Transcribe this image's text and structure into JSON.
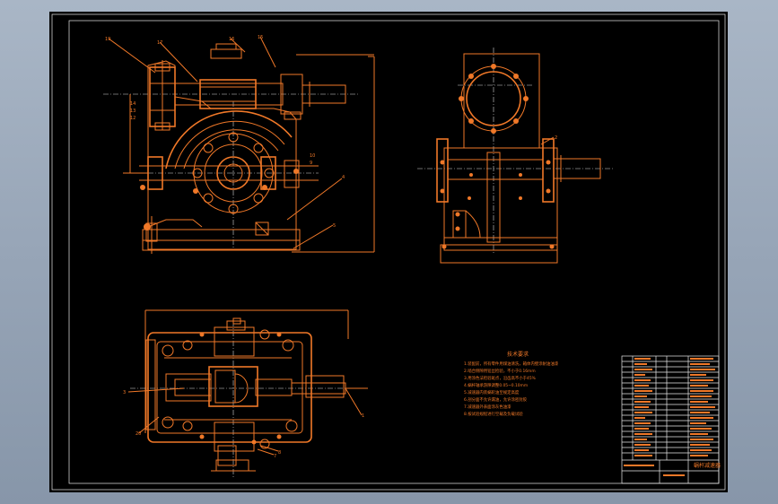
{
  "drawing": {
    "notes_title": "技术要求",
    "notes_lines": [
      "1.装配前，所有零件用煤油清洗，箱体内壁涂耐油油漆",
      "2.啮合侧隙用铅丝检验，不小于0.16mm",
      "3.用涂色法检验斑点，沿齿高不小于45%",
      "4.蜗杆轴承游隙调整0.05~0.10mm",
      "5.减速器内装蜗轮油至规定高度",
      "6.剖分面不允许漏油，允许涂密封胶",
      "7.减速器外表面涂灰色油漆",
      "8.按试验规程进行空载及负载试验"
    ],
    "title_block_name": "蜗杆减速器"
  },
  "colors": {
    "line": "#f07828",
    "background": "#000000",
    "border": "#e8e8e8"
  }
}
